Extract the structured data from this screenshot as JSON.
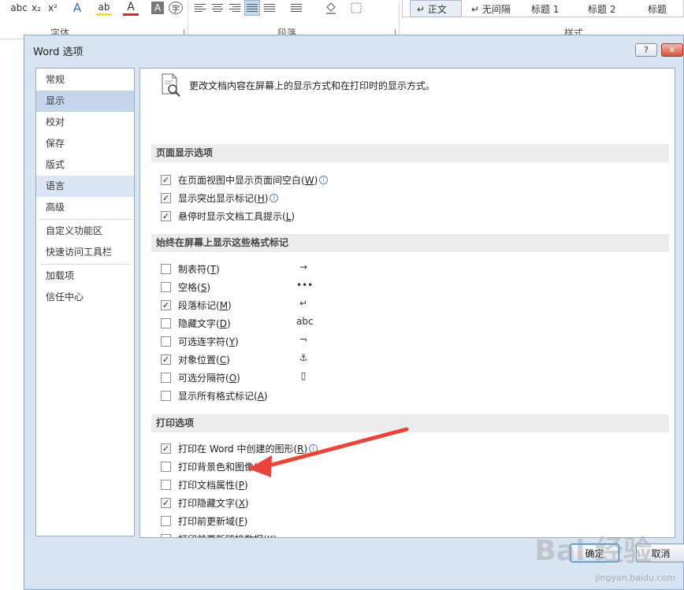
{
  "ribbon": {
    "font_tools": [
      "abc",
      "x₂",
      "x²",
      "A",
      "ab",
      "A",
      "A",
      "字"
    ],
    "group_font": "字体",
    "group_paragraph": "段落",
    "group_styles": "样式",
    "styles": [
      "↵ 正文",
      "↵ 无间隔",
      "标题 1",
      "标题 2",
      "标题"
    ]
  },
  "dialog": {
    "title": "Word 选项",
    "help_label": "?",
    "close_label": "✕"
  },
  "nav": {
    "items": [
      {
        "label": "常规"
      },
      {
        "label": "显示"
      },
      {
        "label": "校对"
      },
      {
        "label": "保存"
      },
      {
        "label": "版式"
      },
      {
        "label": "语言"
      },
      {
        "label": "高级"
      },
      {
        "label": "自定义功能区"
      },
      {
        "label": "快速访问工具栏"
      },
      {
        "label": "加载项"
      },
      {
        "label": "信任中心"
      }
    ]
  },
  "content": {
    "header": "更改文档内容在屏幕上的显示方式和在打印时的显示方式。",
    "sections": [
      {
        "title": "页面显示选项"
      },
      {
        "title": "始终在屏幕上显示这些格式标记"
      },
      {
        "title": "打印选项"
      }
    ],
    "page_options": [
      {
        "label": "在页面视图中显示页面间空白(",
        "key": "W",
        "checked": true,
        "info": true
      },
      {
        "label": "显示突出显示标记(",
        "key": "H",
        "checked": true,
        "info": true
      },
      {
        "label": "悬停时显示文档工具提示(",
        "key": "L",
        "checked": true,
        "info": false
      }
    ],
    "format_marks": [
      {
        "label": "制表符(",
        "key": "T",
        "checked": false,
        "glyph": "→"
      },
      {
        "label": "空格(",
        "key": "S",
        "checked": false,
        "glyph": "•••"
      },
      {
        "label": "段落标记(",
        "key": "M",
        "checked": true,
        "glyph": "↵"
      },
      {
        "label": "隐藏文字(",
        "key": "D",
        "checked": false,
        "glyph": "abc"
      },
      {
        "label": "可选连字符(",
        "key": "Y",
        "checked": false,
        "glyph": "¬"
      },
      {
        "label": "对象位置(",
        "key": "C",
        "checked": true,
        "glyph": "⚓"
      },
      {
        "label": "可选分隔符(",
        "key": "O",
        "checked": false,
        "glyph": "▯"
      },
      {
        "label": "显示所有格式标记(",
        "key": "A",
        "checked": false,
        "glyph": ""
      }
    ],
    "print_options": [
      {
        "label": "打印在 Word 中创建的图形(",
        "key": "R",
        "checked": true,
        "info": true
      },
      {
        "label": "打印背景色和图像(",
        "key": "B",
        "checked": false,
        "info": false
      },
      {
        "label": "打印文档属性(",
        "key": "P",
        "checked": false,
        "info": false
      },
      {
        "label": "打印隐藏文字(",
        "key": "X",
        "checked": true,
        "info": false
      },
      {
        "label": "打印前更新域(",
        "key": "F",
        "checked": false,
        "info": false
      },
      {
        "label": "打印前更新链接数据(",
        "key": "K",
        "checked": false,
        "info": false
      }
    ]
  },
  "buttons": {
    "ok": "确定",
    "cancel": "取消"
  },
  "watermark": {
    "logo": "Bai 经验",
    "url": "jingyan.baidu.com"
  },
  "colors": {
    "annotation_arrow": "#e8443a",
    "dialog_bg": "#d8e4f2",
    "nav_selected": "#c5d5ec"
  }
}
